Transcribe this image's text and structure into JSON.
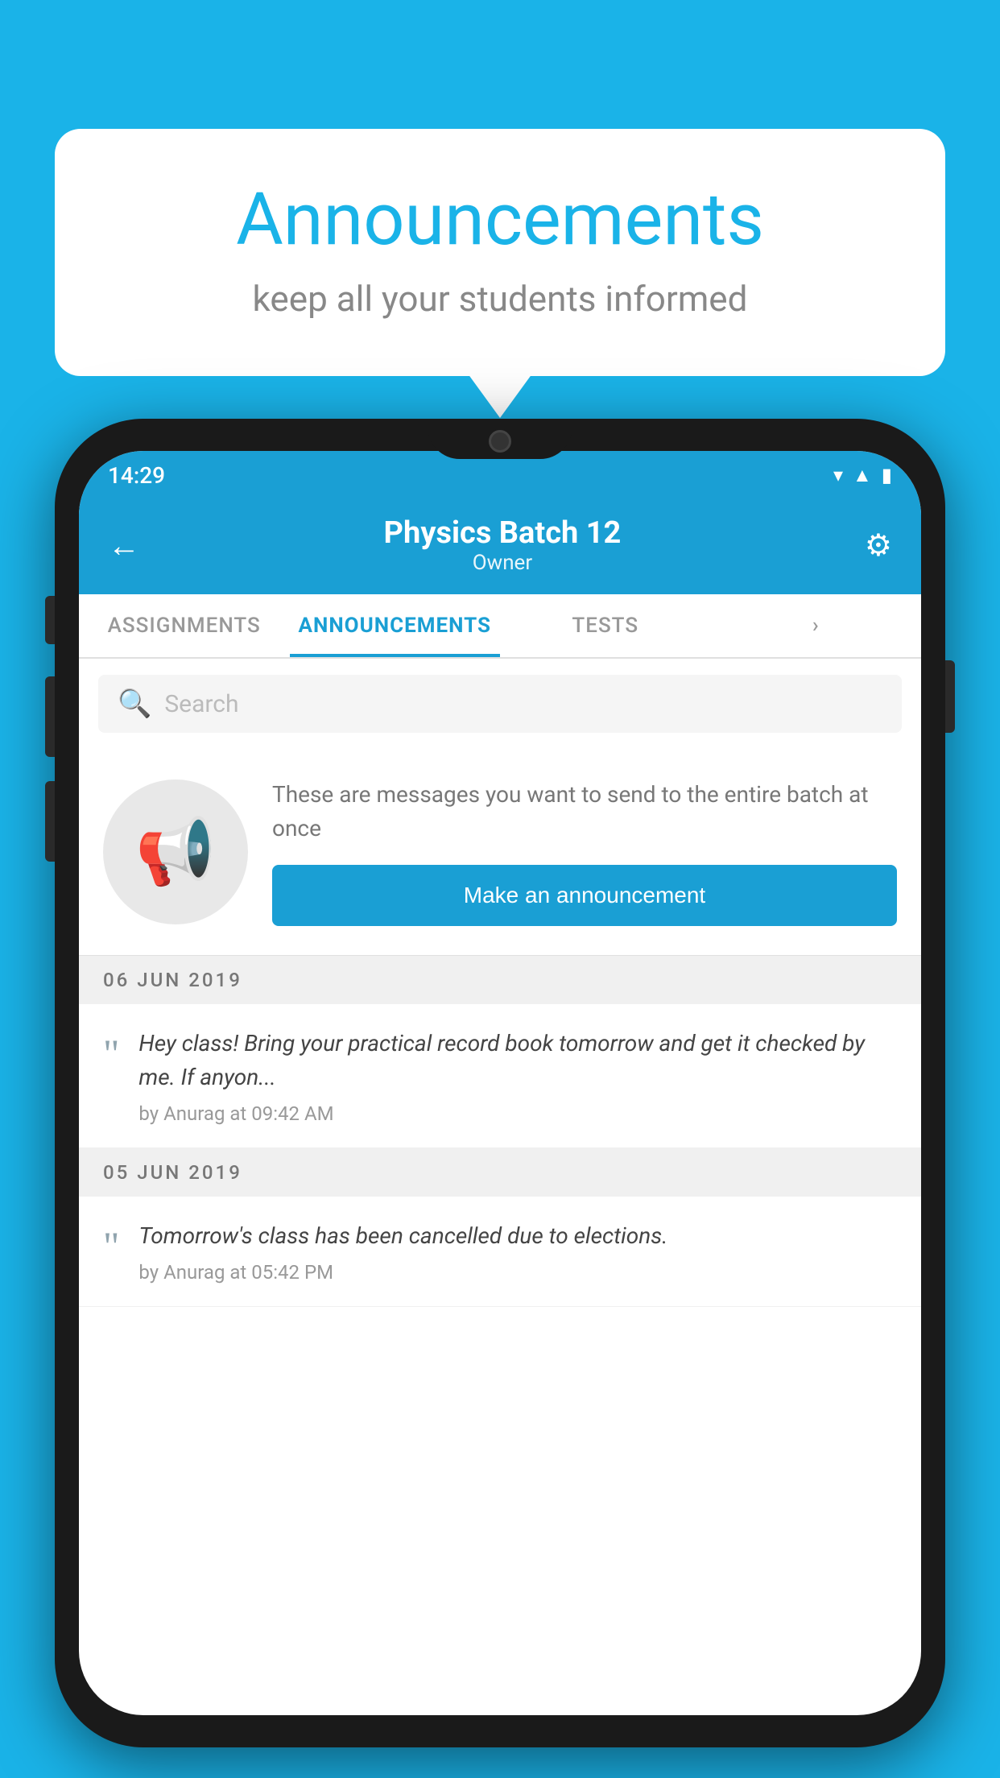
{
  "background_color": "#1ab3e8",
  "speech_bubble": {
    "title": "Announcements",
    "subtitle": "keep all your students informed"
  },
  "phone": {
    "status_bar": {
      "time": "14:29",
      "icons": [
        "wifi",
        "signal",
        "battery"
      ]
    },
    "header": {
      "title": "Physics Batch 12",
      "subtitle": "Owner",
      "back_label": "←",
      "gear_label": "⚙"
    },
    "tabs": [
      {
        "label": "ASSIGNMENTS",
        "active": false
      },
      {
        "label": "ANNOUNCEMENTS",
        "active": true
      },
      {
        "label": "TESTS",
        "active": false
      },
      {
        "label": "...",
        "active": false
      }
    ],
    "search": {
      "placeholder": "Search"
    },
    "announcement_prompt": {
      "description": "These are messages you want to send to the entire batch at once",
      "button_label": "Make an announcement"
    },
    "announcements": [
      {
        "date": "06  JUN  2019",
        "text": "Hey class! Bring your practical record book tomorrow and get it checked by me. If anyon...",
        "meta": "by Anurag at 09:42 AM"
      },
      {
        "date": "05  JUN  2019",
        "text": "Tomorrow's class has been cancelled due to elections.",
        "meta": "by Anurag at 05:42 PM"
      }
    ]
  }
}
